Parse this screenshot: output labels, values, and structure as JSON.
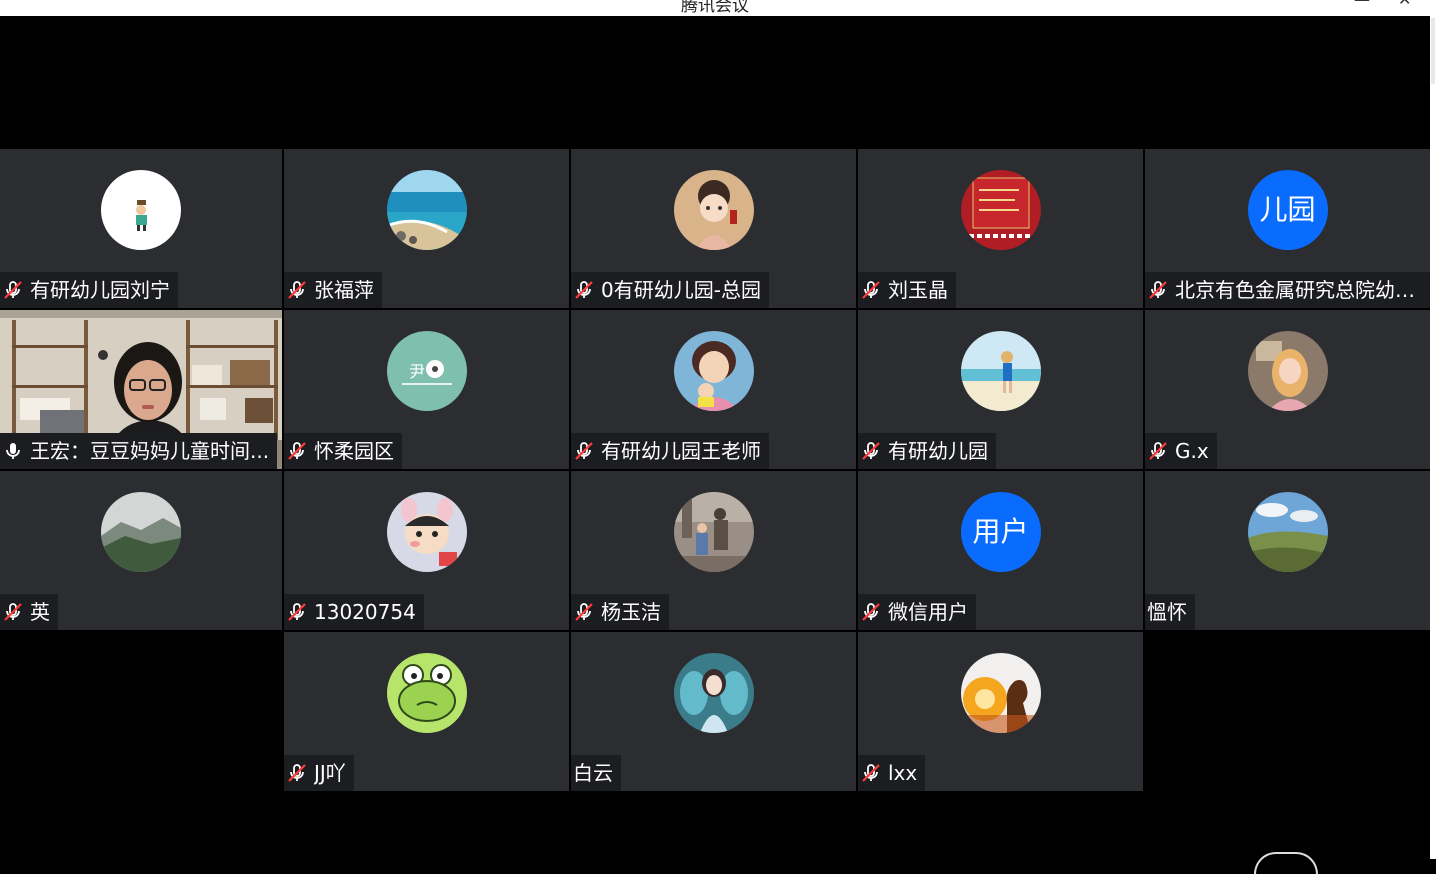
{
  "window": {
    "title": "腾讯会议",
    "controls": [
      "—",
      "✕"
    ]
  },
  "participants": [
    {
      "name": "有研幼儿园刘宁",
      "muted": true,
      "avatar": "cartoon-person-avatar"
    },
    {
      "name": "张福萍",
      "muted": true,
      "avatar": "sea-beach-avatar"
    },
    {
      "name": "0有研幼儿园-总园",
      "muted": true,
      "avatar": "chinese-girl-avatar"
    },
    {
      "name": "刘玉晶",
      "muted": true,
      "avatar": "red-greeting-avatar"
    },
    {
      "name": "北京有色金属研究总院幼儿园",
      "muted": true,
      "avatar_text": "儿园"
    },
    {
      "name": "王宏：豆豆妈妈儿童时间...",
      "muted": false,
      "video": true
    },
    {
      "name": "怀柔园区",
      "muted": true,
      "avatar": "sheep-logo-avatar"
    },
    {
      "name": "有研幼儿园王老师",
      "muted": true,
      "avatar": "cartoon-mother-avatar"
    },
    {
      "name": "有研幼儿园",
      "muted": true,
      "avatar": "beach-person-avatar"
    },
    {
      "name": "G.x",
      "muted": true,
      "avatar": "girl-illustration-avatar"
    },
    {
      "name": "英",
      "muted": true,
      "avatar": "mountain-avatar"
    },
    {
      "name": "13020754",
      "muted": true,
      "avatar": "crayon-boy-avatar"
    },
    {
      "name": "杨玉洁",
      "muted": true,
      "avatar": "statue-photo-avatar"
    },
    {
      "name": "微信用户",
      "muted": true,
      "avatar_text": "用户"
    },
    {
      "name": "慍怀",
      "muted": false,
      "avatar": "hills-landscape-avatar"
    },
    {
      "name": "JJ吖",
      "muted": true,
      "avatar": "frog-avatar"
    },
    {
      "name": "白云",
      "muted": false,
      "avatar": "fairy-girl-avatar"
    },
    {
      "name": "lxx",
      "muted": true,
      "avatar": "sunset-silhouette-avatar"
    }
  ],
  "colors": {
    "tile": "#2b2d31",
    "label_bg": "#1c1d20",
    "text_avatar": "#0a6cff",
    "active_border": "#3fd36b"
  }
}
